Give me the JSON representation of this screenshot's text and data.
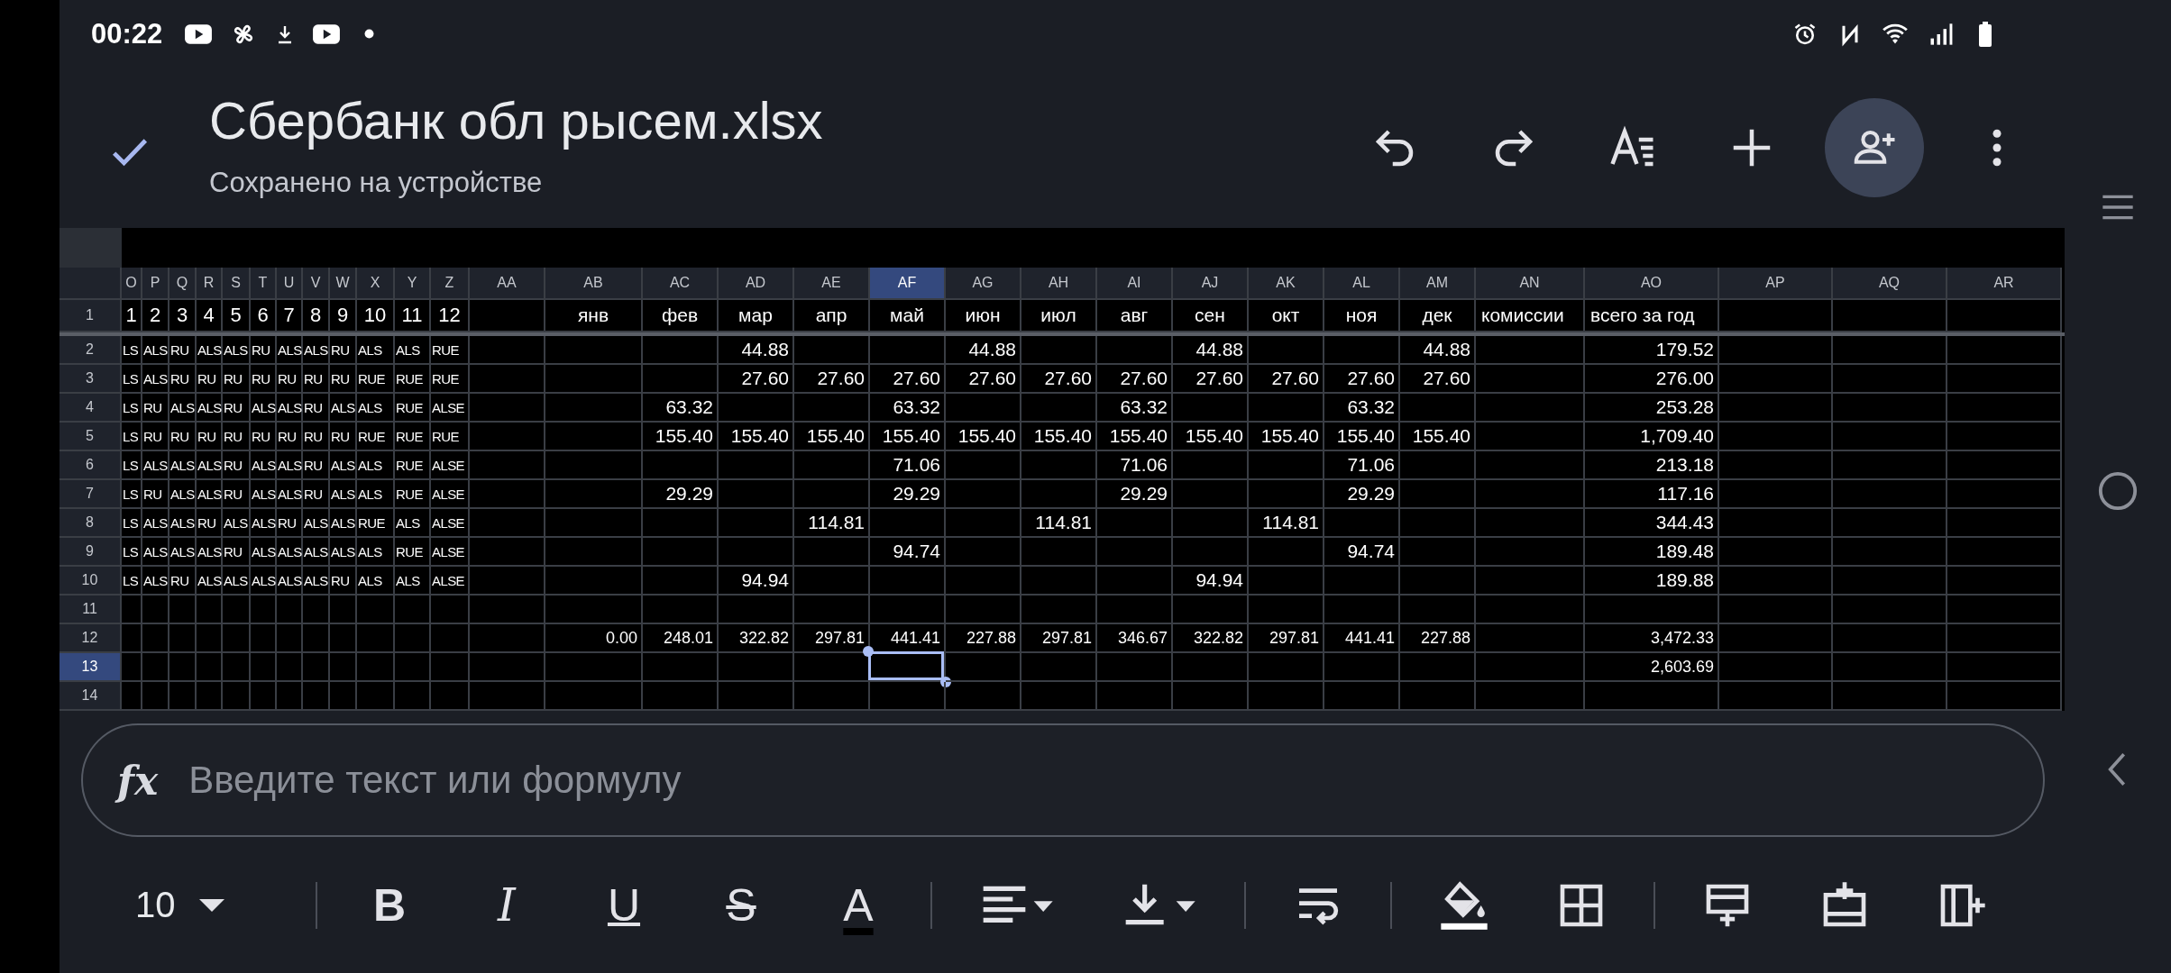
{
  "status_bar": {
    "time": "00:22"
  },
  "header": {
    "title": "Сбербанк обл рысем.xlsx",
    "subtitle": "Сохранено на устройстве"
  },
  "sheet": {
    "columns": [
      {
        "label": "O",
        "selected": false
      },
      {
        "label": "P",
        "selected": false
      },
      {
        "label": "Q",
        "selected": false
      },
      {
        "label": "R",
        "selected": false
      },
      {
        "label": "S",
        "selected": false
      },
      {
        "label": "T",
        "selected": false
      },
      {
        "label": "U",
        "selected": false
      },
      {
        "label": "V",
        "selected": false
      },
      {
        "label": "W",
        "selected": false
      },
      {
        "label": "X",
        "selected": false
      },
      {
        "label": "Y",
        "selected": false
      },
      {
        "label": "Z",
        "selected": false
      },
      {
        "label": "AA",
        "selected": false
      },
      {
        "label": "AB",
        "selected": false
      },
      {
        "label": "AC",
        "selected": false
      },
      {
        "label": "AD",
        "selected": false
      },
      {
        "label": "AE",
        "selected": false
      },
      {
        "label": "AF",
        "selected": true
      },
      {
        "label": "AG",
        "selected": false
      },
      {
        "label": "AH",
        "selected": false
      },
      {
        "label": "AI",
        "selected": false
      },
      {
        "label": "AJ",
        "selected": false
      },
      {
        "label": "AK",
        "selected": false
      },
      {
        "label": "AL",
        "selected": false
      },
      {
        "label": "AM",
        "selected": false
      },
      {
        "label": "AN",
        "selected": false
      },
      {
        "label": "AO",
        "selected": false
      },
      {
        "label": "AP",
        "selected": false
      },
      {
        "label": "AQ",
        "selected": false
      },
      {
        "label": "AR",
        "selected": false
      }
    ],
    "rows": [
      {
        "label": "1",
        "selected": false,
        "kind": "header",
        "cells": [
          "1",
          "2",
          "3",
          "4",
          "5",
          "6",
          "7",
          "8",
          "9",
          "10",
          "11",
          "12",
          null,
          "янв",
          "фев",
          "мар",
          "апр",
          "май",
          "июн",
          "июл",
          "авг",
          "сен",
          "окт",
          "ноя",
          "дек",
          "комиссии",
          "всего за год"
        ]
      },
      {
        "label": "2",
        "selected": false,
        "kind": "data",
        "cells": [
          "LS",
          "ALS",
          "RU",
          "ALS",
          "ALS",
          "RU",
          "ALS",
          "ALS",
          "RU",
          "ALS",
          "ALS",
          "RUE",
          null,
          null,
          null,
          "44.88",
          null,
          null,
          "44.88",
          null,
          null,
          "44.88",
          null,
          null,
          "44.88",
          null,
          "179.52"
        ]
      },
      {
        "label": "3",
        "selected": false,
        "kind": "data",
        "cells": [
          "LS",
          "ALS",
          "RU",
          "RU",
          "RU",
          "RU",
          "RU",
          "RU",
          "RU",
          "RUE",
          "RUE",
          "RUE",
          null,
          null,
          null,
          "27.60",
          "27.60",
          "27.60",
          "27.60",
          "27.60",
          "27.60",
          "27.60",
          "27.60",
          "27.60",
          "27.60",
          null,
          "276.00"
        ]
      },
      {
        "label": "4",
        "selected": false,
        "kind": "data",
        "cells": [
          "LS",
          "RU",
          "ALS",
          "ALS",
          "RU",
          "ALS",
          "ALS",
          "RU",
          "ALS",
          "ALS",
          "RUE",
          "ALSE",
          null,
          null,
          "63.32",
          null,
          null,
          "63.32",
          null,
          null,
          "63.32",
          null,
          null,
          "63.32",
          null,
          null,
          "253.28"
        ]
      },
      {
        "label": "5",
        "selected": false,
        "kind": "data",
        "cells": [
          "LS",
          "RU",
          "RU",
          "RU",
          "RU",
          "RU",
          "RU",
          "RU",
          "RU",
          "RUE",
          "RUE",
          "RUE",
          null,
          null,
          "155.40",
          "155.40",
          "155.40",
          "155.40",
          "155.40",
          "155.40",
          "155.40",
          "155.40",
          "155.40",
          "155.40",
          "155.40",
          null,
          "1,709.40"
        ]
      },
      {
        "label": "6",
        "selected": false,
        "kind": "data",
        "cells": [
          "LS",
          "ALS",
          "ALS",
          "ALS",
          "RU",
          "ALS",
          "ALS",
          "RU",
          "ALS",
          "ALS",
          "RUE",
          "ALSE",
          null,
          null,
          null,
          null,
          null,
          "71.06",
          null,
          null,
          "71.06",
          null,
          null,
          "71.06",
          null,
          null,
          "213.18"
        ]
      },
      {
        "label": "7",
        "selected": false,
        "kind": "data",
        "cells": [
          "LS",
          "RU",
          "ALS",
          "ALS",
          "RU",
          "ALS",
          "ALS",
          "RU",
          "ALS",
          "ALS",
          "RUE",
          "ALSE",
          null,
          null,
          "29.29",
          null,
          null,
          "29.29",
          null,
          null,
          "29.29",
          null,
          null,
          "29.29",
          null,
          null,
          "117.16"
        ]
      },
      {
        "label": "8",
        "selected": false,
        "kind": "data",
        "cells": [
          "LS",
          "ALS",
          "ALS",
          "RU",
          "ALS",
          "ALS",
          "RU",
          "ALS",
          "ALS",
          "RUE",
          "ALS",
          "ALSE",
          null,
          null,
          null,
          null,
          "114.81",
          null,
          null,
          "114.81",
          null,
          null,
          "114.81",
          null,
          null,
          null,
          "344.43"
        ]
      },
      {
        "label": "9",
        "selected": false,
        "kind": "data",
        "cells": [
          "LS",
          "ALS",
          "ALS",
          "ALS",
          "RU",
          "ALS",
          "ALS",
          "ALS",
          "ALS",
          "ALS",
          "RUE",
          "ALSE",
          null,
          null,
          null,
          null,
          null,
          "94.74",
          null,
          null,
          null,
          null,
          null,
          "94.74",
          null,
          null,
          "189.48"
        ]
      },
      {
        "label": "10",
        "selected": false,
        "kind": "data",
        "cells": [
          "LS",
          "ALS",
          "RU",
          "ALS",
          "ALS",
          "ALS",
          "ALS",
          "ALS",
          "RU",
          "ALS",
          "ALS",
          "ALSE",
          null,
          null,
          null,
          "94.94",
          null,
          null,
          null,
          null,
          null,
          "94.94",
          null,
          null,
          null,
          null,
          "189.88"
        ]
      },
      {
        "label": "11",
        "selected": false,
        "kind": "data"
      },
      {
        "label": "12",
        "selected": false,
        "kind": "total",
        "cells": [
          null,
          null,
          null,
          null,
          null,
          null,
          null,
          null,
          null,
          null,
          null,
          null,
          null,
          "0.00",
          "248.01",
          "322.82",
          "297.81",
          "441.41",
          "227.88",
          "297.81",
          "346.67",
          "322.82",
          "297.81",
          "441.41",
          "227.88",
          null,
          "3,472.33"
        ]
      },
      {
        "label": "13",
        "selected": true,
        "kind": "total",
        "cells": [
          null,
          null,
          null,
          null,
          null,
          null,
          null,
          null,
          null,
          null,
          null,
          null,
          null,
          null,
          null,
          null,
          null,
          null,
          null,
          null,
          null,
          null,
          null,
          null,
          null,
          null,
          "2,603.69"
        ]
      },
      {
        "label": "14",
        "selected": false,
        "kind": "data"
      }
    ]
  },
  "formula_bar": {
    "label": "fx",
    "placeholder": "Введите текст или формулу"
  },
  "toolbar": {
    "font_size": "10",
    "format_buttons": [
      {
        "kind": "bold",
        "glyph": "B"
      },
      {
        "kind": "italic",
        "glyph": "I"
      },
      {
        "kind": "underline",
        "glyph": "U"
      },
      {
        "kind": "strikethrough",
        "glyph": "S"
      },
      {
        "kind": "text_color",
        "glyph": "A"
      }
    ]
  }
}
